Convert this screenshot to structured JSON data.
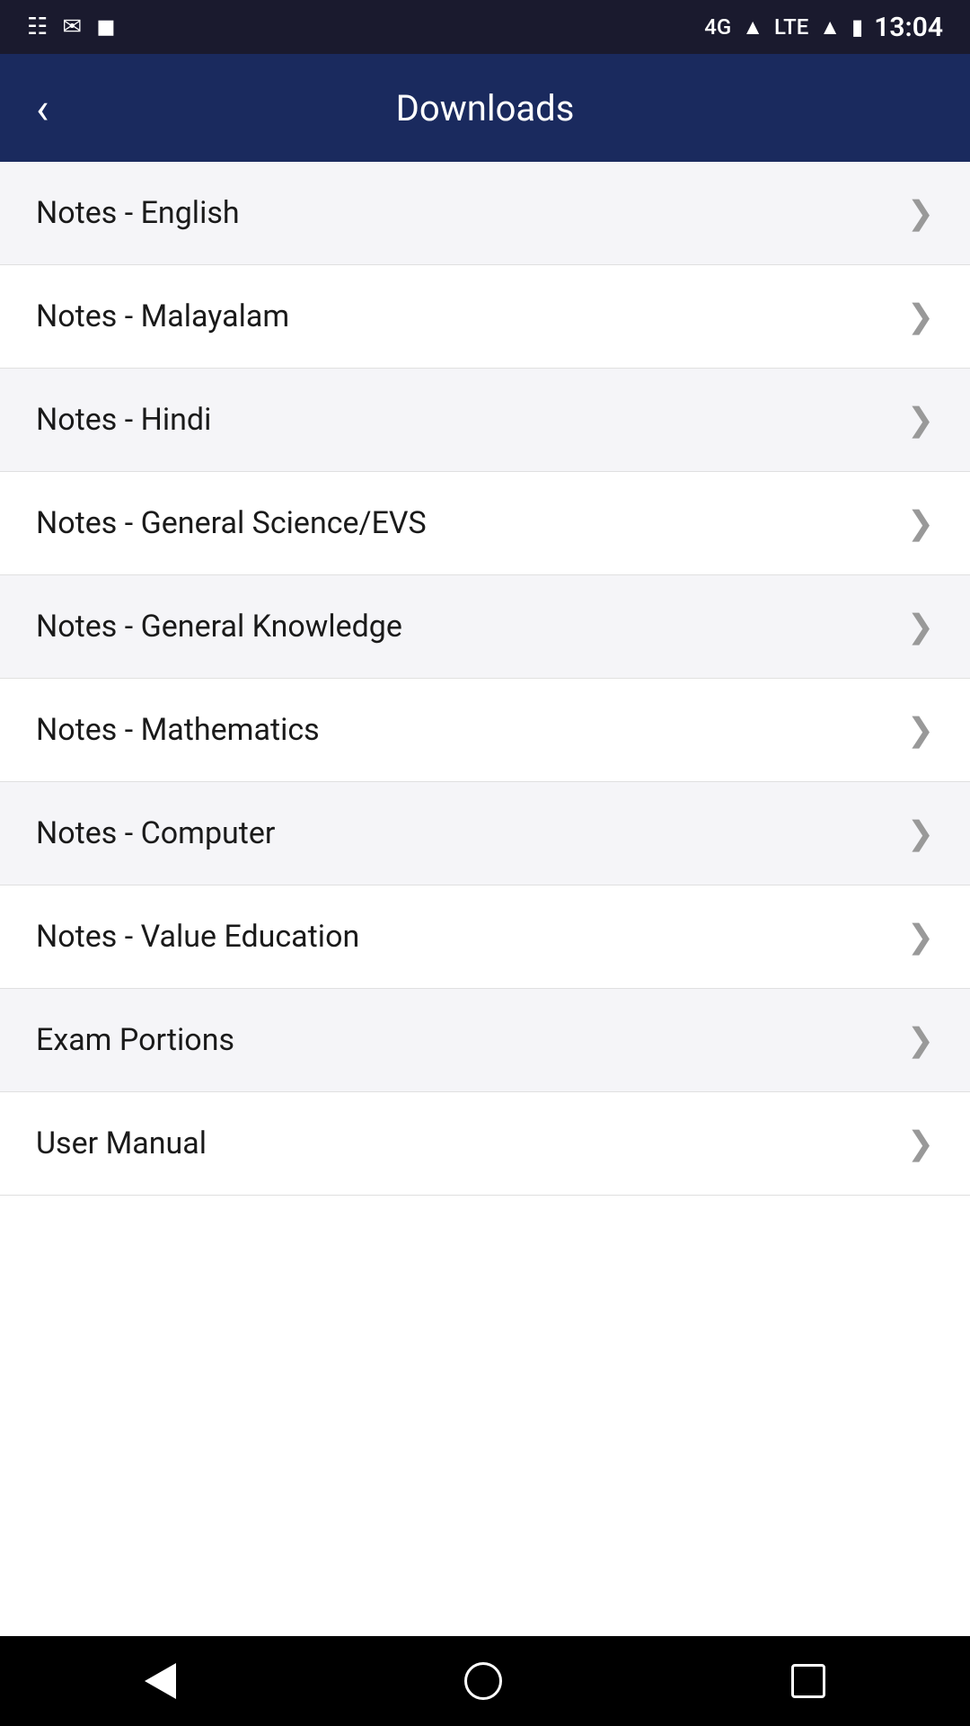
{
  "statusBar": {
    "time": "13:04",
    "icons": [
      "message-icon",
      "bell-icon",
      "image-icon",
      "phone-icon",
      "signal-4g-icon",
      "lte-icon",
      "signal-icon",
      "battery-icon"
    ]
  },
  "appBar": {
    "title": "Downloads",
    "backLabel": "‹"
  },
  "listItems": [
    {
      "id": 1,
      "label": "Notes - English"
    },
    {
      "id": 2,
      "label": "Notes - Malayalam"
    },
    {
      "id": 3,
      "label": "Notes - Hindi"
    },
    {
      "id": 4,
      "label": "Notes - General Science/EVS"
    },
    {
      "id": 5,
      "label": "Notes - General Knowledge"
    },
    {
      "id": 6,
      "label": "Notes - Mathematics"
    },
    {
      "id": 7,
      "label": "Notes - Computer"
    },
    {
      "id": 8,
      "label": "Notes - Value Education"
    },
    {
      "id": 9,
      "label": "Exam Portions"
    },
    {
      "id": 10,
      "label": "User Manual"
    }
  ]
}
